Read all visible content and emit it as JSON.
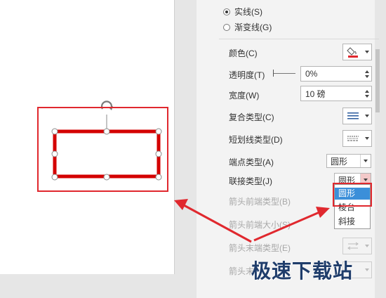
{
  "line_type": {
    "solid_label": "实线(S)",
    "gradient_label": "渐变线(G)",
    "selected": "solid"
  },
  "properties": {
    "color_label": "颜色(C)",
    "transparency_label": "透明度(T)",
    "transparency_value": "0%",
    "width_label": "宽度(W)",
    "width_value": "10 磅",
    "compound_type_label": "复合类型(C)",
    "dash_type_label": "短划线类型(D)",
    "cap_type_label": "端点类型(A)",
    "cap_type_value": "圆形",
    "join_type_label": "联接类型(J)",
    "join_type_value": "圆形",
    "arrow_begin_type_label": "箭头前端类型(B)",
    "arrow_begin_size_label": "箭头前端大小(S)",
    "arrow_end_type_label": "箭头末端类型(E)",
    "arrow_end_size_label": "箭头末"
  },
  "join_menu": {
    "options": [
      "圆形",
      "棱台",
      "斜接"
    ],
    "selected_index": 0
  },
  "colors": {
    "shape_outline": "#d40000",
    "highlight": "#e0282e",
    "menu_selection": "#3b8fd9",
    "watermark": "#1f3d6b"
  },
  "watermark_text": "极速下载站"
}
